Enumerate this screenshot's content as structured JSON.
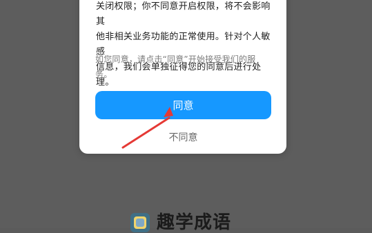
{
  "app": {
    "name": "趣学成语"
  },
  "dialog": {
    "body_lines": [
      "关闭权限；你不同意开启权限，将不会影响其",
      "他非相关业务功能的正常使用。针对个人敏感",
      "信息，我们会单独征得您的同意后进行处理。"
    ],
    "note_lines": [
      "如您同意，请点击“同意”开始接受我们的服",
      "务。"
    ],
    "agree_label": "同意",
    "disagree_label": "不同意"
  },
  "colors": {
    "overlay": "#5d5d5d",
    "dialog": "#ffffff",
    "primary": "#1698ff",
    "annotation_arrow": "#e53935"
  },
  "icons": {
    "app_logo": "app-logo-icon",
    "annotation": "red-arrow-icon"
  }
}
